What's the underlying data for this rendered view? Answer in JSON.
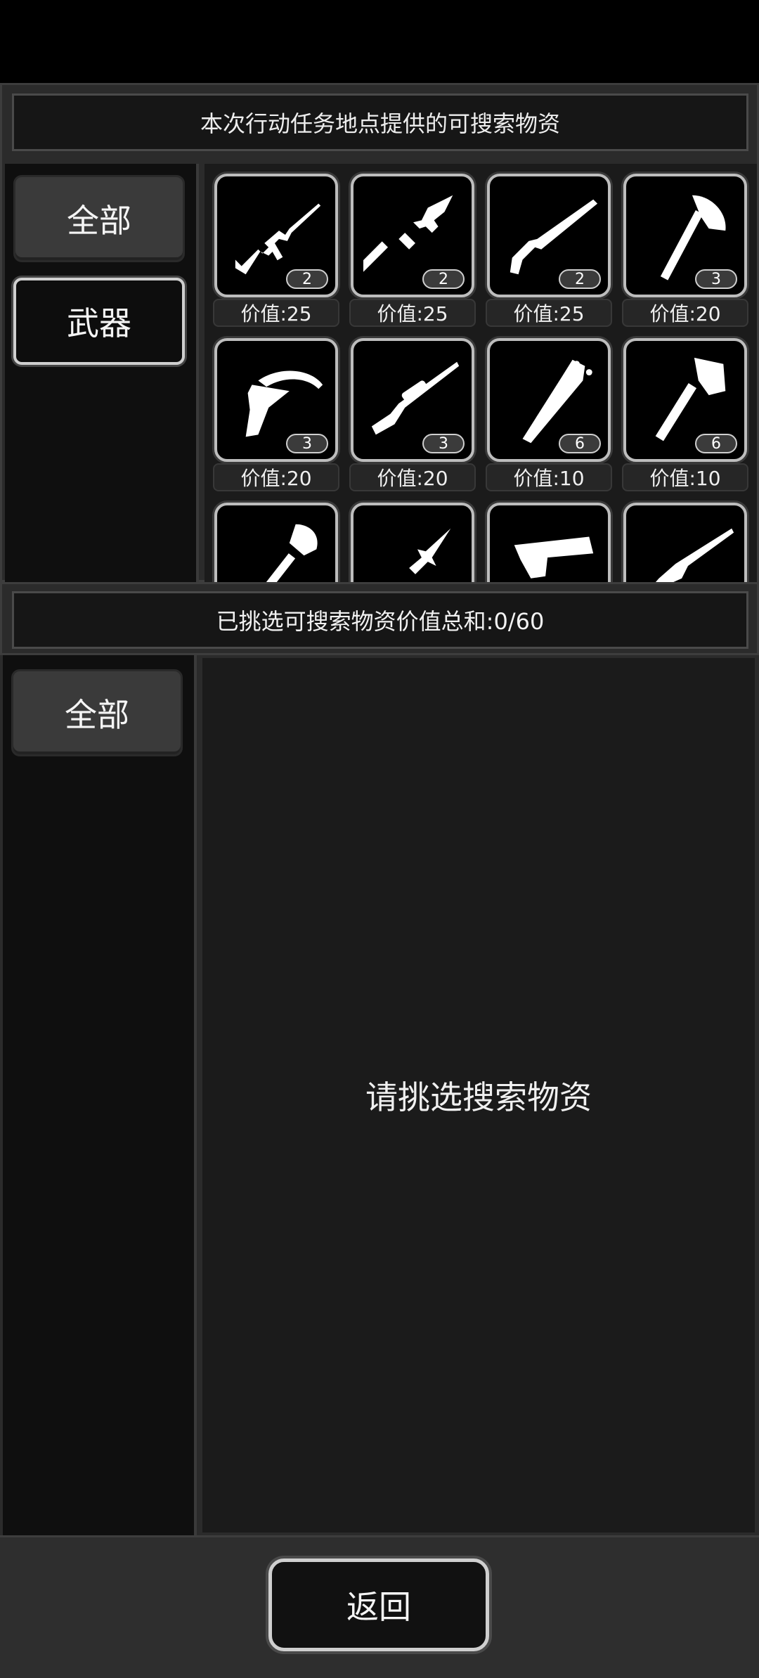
{
  "header": {
    "title": "本次行动任务地点提供的可搜索物资"
  },
  "categories_top": [
    {
      "label": "全部",
      "active": false
    },
    {
      "label": "武器",
      "active": true
    }
  ],
  "items": [
    {
      "icon": "assault-rifle-icon",
      "count": "2",
      "value": "价值:25"
    },
    {
      "icon": "spear-icon",
      "count": "2",
      "value": "价值:25"
    },
    {
      "icon": "shotgun-icon",
      "count": "2",
      "value": "价值:25"
    },
    {
      "icon": "axe-icon",
      "count": "3",
      "value": "价值:20"
    },
    {
      "icon": "crossbow-icon",
      "count": "3",
      "value": "价值:20"
    },
    {
      "icon": "sniper-rifle-icon",
      "count": "3",
      "value": "价值:20"
    },
    {
      "icon": "spiked-bat-icon",
      "count": "6",
      "value": "价值:10"
    },
    {
      "icon": "hatchet-icon",
      "count": "6",
      "value": "价值:10"
    },
    {
      "icon": "shovel-icon",
      "count": "",
      "value": ""
    },
    {
      "icon": "spear-tip-icon",
      "count": "",
      "value": ""
    },
    {
      "icon": "pistol-icon",
      "count": "",
      "value": ""
    },
    {
      "icon": "ak-rifle-icon",
      "count": "",
      "value": ""
    }
  ],
  "selection": {
    "total_label": "已挑选可搜索物资价值总和:0/60",
    "empty_hint": "请挑选搜索物资"
  },
  "categories_bottom": [
    {
      "label": "全部",
      "active": false
    }
  ],
  "footer": {
    "back_label": "返回"
  }
}
